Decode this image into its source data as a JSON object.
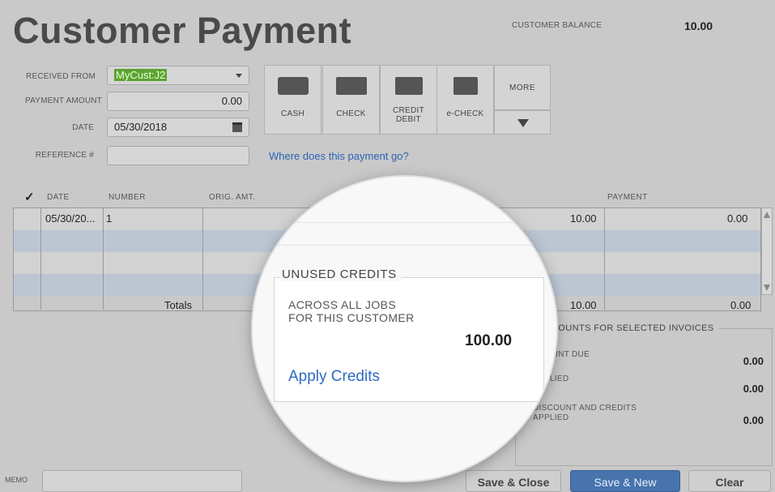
{
  "header": {
    "title": "Customer Payment",
    "balance_label": "CUSTOMER BALANCE",
    "balance_value": "10.00"
  },
  "form": {
    "received_from_label": "RECEIVED FROM",
    "received_from_value": "MyCust:J2",
    "payment_amount_label": "PAYMENT AMOUNT",
    "payment_amount_value": "0.00",
    "date_label": "DATE",
    "date_value": "05/30/2018",
    "reference_label": "REFERENCE #",
    "reference_value": ""
  },
  "payment_methods": [
    {
      "label": "CASH",
      "icon": "cash-icon"
    },
    {
      "label": "CHECK",
      "icon": "check-icon"
    },
    {
      "label": "CREDIT DEBIT",
      "icon": "credit-card-icon"
    },
    {
      "label": "e-CHECK",
      "icon": "echeck-icon"
    }
  ],
  "more_label": "MORE",
  "help_link": "Where does this payment go?",
  "table": {
    "headers": {
      "check": "✓",
      "date": "DATE",
      "number": "NUMBER",
      "orig_amt": "ORIG. AMT.",
      "payment": "PAYMENT"
    },
    "rows": [
      {
        "date": "05/30/20...",
        "number": "1",
        "amt_due": "10.00",
        "payment": "0.00"
      }
    ],
    "totals_label": "Totals",
    "totals_amt_due": "10.00",
    "totals_payment": "0.00"
  },
  "amounts": {
    "heading": "AMOUNTS FOR SELECTED INVOICES",
    "amount_due_label": "AMOUNT DUE",
    "amount_due_value": "0.00",
    "applied_label": "APPLIED",
    "applied_value": "0.00",
    "discount_label_1": "DISCOUNT AND CREDITS",
    "discount_label_2": "APPLIED",
    "discount_value": "0.00"
  },
  "memo_label": "MEMO",
  "buttons": {
    "save_close": "Save & Close",
    "save_new": "Save & New",
    "clear": "Clear"
  },
  "unused_credits": {
    "title": "UNUSED CREDITS",
    "line1": "ACROSS ALL JOBS",
    "line2": "FOR THIS CUSTOMER",
    "amount": "100.00",
    "link": "Apply Credits"
  }
}
